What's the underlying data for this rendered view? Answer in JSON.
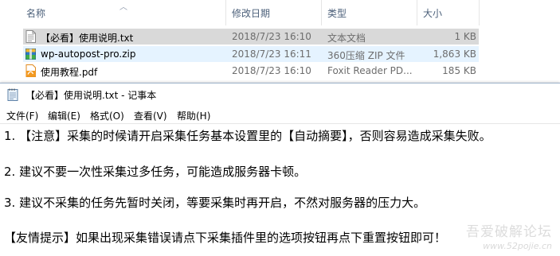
{
  "explorer": {
    "columns": {
      "name": "名称",
      "modified": "修改日期",
      "type": "类型",
      "size": "大小"
    },
    "files": [
      {
        "name": "【必看】使用说明.txt",
        "modified": "2018/7/23 16:10",
        "type": "文本文档",
        "size": "1 KB",
        "icon": "text-file-icon",
        "state": "selected"
      },
      {
        "name": "wp-autopost-pro.zip",
        "modified": "2018/7/23 16:11",
        "type": "360压缩 ZIP 文件",
        "size": "1,863 KB",
        "icon": "zip-archive-icon",
        "state": "hover"
      },
      {
        "name": "使用教程.pdf",
        "modified": "2018/7/23 16:10",
        "type": "Foxit Reader PD...",
        "size": "185 KB",
        "icon": "pdf-file-icon",
        "state": "normal"
      }
    ]
  },
  "notepad": {
    "title": "【必看】使用说明.txt - 记事本",
    "menu": [
      "文件(F)",
      "编辑(E)",
      "格式(O)",
      "查看(V)",
      "帮助(H)"
    ],
    "lines": [
      "1. 【注意】采集的时候请开启采集任务基本设置里的【自动摘要】，否则容易造成采集失败。",
      "2. 建议不要一次性采集过多任务，可能造成服务器卡顿。",
      "3. 建议不采集的任务先暂时关闭，等要采集时再开启，不然对服务器的压力大。",
      "【友情提示】如果出现采集错误请点下采集插件里的选项按钮再点下重置按钮即可！"
    ]
  },
  "watermark": {
    "text": "吾爱破解论坛",
    "url": "www.52pojie.cn"
  }
}
